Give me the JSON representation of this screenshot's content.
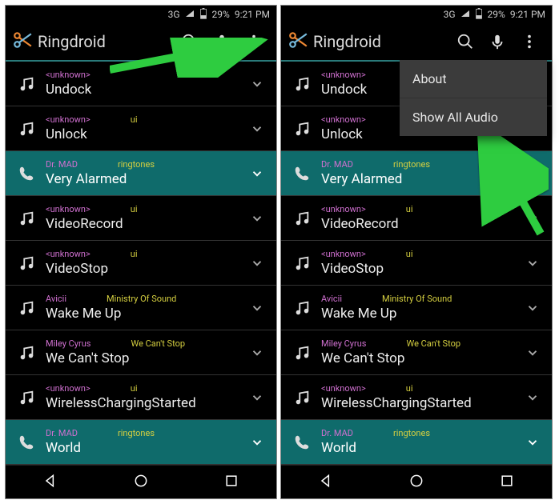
{
  "status": {
    "network": "3G",
    "battery": "29%",
    "time": "9:21 PM"
  },
  "app": {
    "title": "Ringdroid"
  },
  "list": [
    {
      "artist": "<unknown>",
      "album": "",
      "title": "Undock",
      "type": "music",
      "hl": false
    },
    {
      "artist": "<unknown>",
      "album": "ui",
      "title": "Unlock",
      "type": "music",
      "hl": false
    },
    {
      "artist": "Dr. MAD",
      "album": "ringtones",
      "title": "Very Alarmed",
      "type": "ringtone",
      "hl": true
    },
    {
      "artist": "<unknown>",
      "album": "ui",
      "title": "VideoRecord",
      "type": "music",
      "hl": false
    },
    {
      "artist": "<unknown>",
      "album": "ui",
      "title": "VideoStop",
      "type": "music",
      "hl": false
    },
    {
      "artist": "Avicii",
      "album": "Ministry Of Sound",
      "title": "Wake Me Up",
      "type": "music",
      "hl": false
    },
    {
      "artist": "Miley Cyrus",
      "album": "We Can't Stop",
      "title": "We Can't Stop",
      "type": "music",
      "hl": false
    },
    {
      "artist": "<unknown>",
      "album": "ui",
      "title": "WirelessChargingStarted",
      "type": "music",
      "hl": false
    },
    {
      "artist": "Dr. MAD",
      "album": "ringtones",
      "title": "World",
      "type": "ringtone",
      "hl": true
    }
  ],
  "menu": {
    "about": "About",
    "show_all": "Show All Audio"
  }
}
